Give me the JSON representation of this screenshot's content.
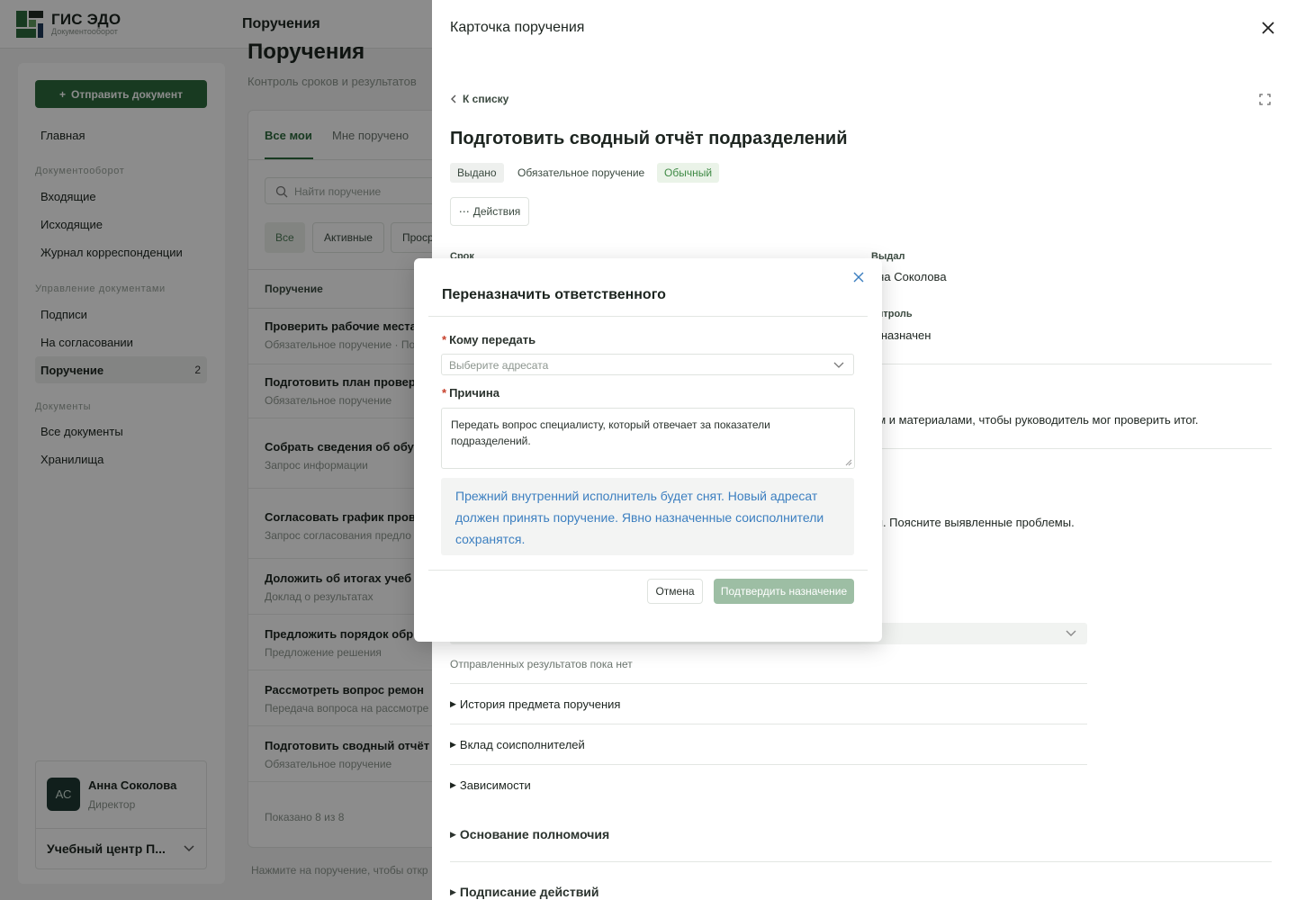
{
  "brand": {
    "title": "ГИС ЭДО",
    "subtitle": "Документооборот"
  },
  "topbar": {
    "title": "Поручения"
  },
  "sidebar": {
    "send_button": "Отправить документ",
    "items": [
      {
        "label": "Главная"
      },
      {
        "label": "Входящие"
      },
      {
        "label": "Исходящие"
      },
      {
        "label": "Журнал корреспонденции"
      },
      {
        "label": "Подписи"
      },
      {
        "label": "На согласовании"
      },
      {
        "label": "Поручение",
        "badge": "2"
      },
      {
        "label": "Все документы"
      },
      {
        "label": "Хранилища"
      }
    ],
    "sections": [
      "Документооборот",
      "Управление документами",
      "Документы"
    ],
    "user": {
      "initials": "АС",
      "name": "Анна Соколова",
      "role": "Директор"
    },
    "org": "Учебный центр П..."
  },
  "page": {
    "title": "Поручения",
    "subtitle": "Контроль сроков и результатов",
    "tabs": [
      "Все мои",
      "Мне поручено"
    ],
    "search_placeholder": "Найти поручение",
    "filters": [
      "Все",
      "Активные",
      "Проср"
    ],
    "column": "Поручение",
    "rows": [
      {
        "title": "Проверить рабочие места",
        "sub": "Обязательное поручение · По"
      },
      {
        "title": "Подготовить план провер",
        "sub": "Обязательное поручение"
      },
      {
        "title": "Собрать сведения об обу",
        "sub": "Запрос информации"
      },
      {
        "title": "Согласовать график пров",
        "sub": "Запрос согласования предло"
      },
      {
        "title": "Доложить об итогах учеб",
        "sub": "Доклад о результатах"
      },
      {
        "title": "Предложить порядок обр",
        "sub": "Предложение решения"
      },
      {
        "title": "Рассмотреть вопрос ремон",
        "sub": "Передача вопроса на рассмотре"
      },
      {
        "title": "Подготовить сводный отчёт",
        "sub": "Обязательное поручение"
      }
    ],
    "footer": "Показано 8 из 8",
    "hint": "Нажмите на поручение, чтобы откр"
  },
  "drawer": {
    "title": "Карточка поручения",
    "back": "К списку",
    "task_title": "Подготовить сводный отчёт подразделений",
    "tags": {
      "status": "Выдано",
      "kind": "Обязательное поручение",
      "priority": "Обычный"
    },
    "actions": "Действия",
    "fields": {
      "deadline_label": "Срок",
      "issuer_label": "Выдал",
      "issuer_value": "нна Соколова",
      "control_label": "онтроль",
      "control_value": "е назначен"
    },
    "text1": "ем и материалами, чтобы руководитель мог проверить итог.",
    "text2": "ки. Поясните выявленные проблемы.",
    "no_results": "Отправленных результатов пока нет",
    "sections": [
      "История предмета поручения",
      "Вклад соисполнителей",
      "Зависимости"
    ],
    "big_sections": [
      "Основание полномочия",
      "Подписание действий"
    ]
  },
  "modal": {
    "title": "Переназначить ответственного",
    "to_label": "Кому передать",
    "to_placeholder": "Выберите адресата",
    "reason_label": "Причина",
    "reason_value": "Передать вопрос специалисту, который отвечает за показатели подразделений.",
    "info": "Прежний внутренний исполнитель будет снят. Новый адресат должен принять поручение. Явно назначенные соисполнители сохранятся.",
    "cancel": "Отмена",
    "confirm": "Подтвердить назначение"
  },
  "colors": {
    "accent": "#2d6a3c",
    "info": "#3c7fc0",
    "required": "#c7402b"
  }
}
